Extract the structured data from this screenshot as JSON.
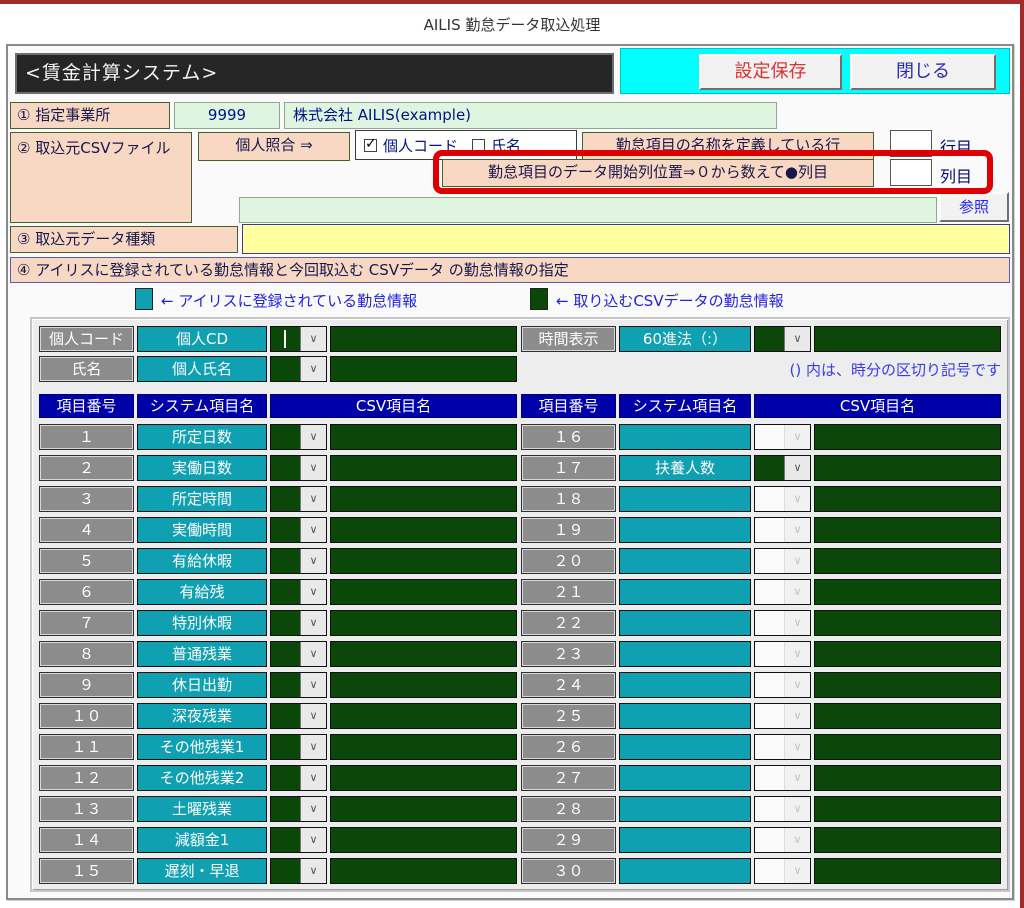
{
  "page": {
    "title": "AILIS 勤怠データ取込処理"
  },
  "header": {
    "system_title": "<賃金計算システム>",
    "save_label": "設定保存",
    "close_label": "閉じる"
  },
  "section1": {
    "label": "① 指定事業所",
    "office_code": "9999",
    "office_name": "株式会社 AILIS(example)"
  },
  "section2": {
    "label": "② 取込元CSVファイル",
    "match_label": "個人照合 ⇒",
    "checkboxes": [
      {
        "label": "個人コード",
        "checked": true
      },
      {
        "label": "氏名",
        "checked": false
      }
    ],
    "header_row_label": "勤怠項目の名称を定義している行",
    "header_row_value": "",
    "header_row_unit": "行目",
    "start_col_label": "勤怠項目のデータ開始列位置⇒０から数えて●列目",
    "start_col_value": "",
    "start_col_unit": "列目",
    "file_path": "",
    "browse_label": "参照"
  },
  "section3": {
    "label": "③ 取込元データ種類",
    "value": ""
  },
  "section4": {
    "banner": "④ アイリスに登録されている勤怠情報と今回取込む CSVデータ の勤怠情報の指定"
  },
  "legend": [
    {
      "label": "← アイリスに登録されている勤怠情報",
      "color": "#0fa0b2"
    },
    {
      "label": "← 取り込むCSVデータの勤怠情報",
      "color": "#0b4708"
    }
  ],
  "mapping": {
    "person_rows": [
      {
        "key": "個人コード",
        "system": "個人CD",
        "csv": ""
      },
      {
        "key": "氏名",
        "system": "個人氏名",
        "csv": ""
      }
    ],
    "time_row": {
      "key": "時間表示",
      "system": "60進法（:）",
      "csv": ""
    },
    "time_note": "() 内は、時分の区切り記号です",
    "headers": [
      "項目番号",
      "システム項目名",
      "CSV項目名"
    ],
    "left_rows": [
      {
        "num": "１",
        "system": "所定日数",
        "csv": ""
      },
      {
        "num": "２",
        "system": "実働日数",
        "csv": ""
      },
      {
        "num": "３",
        "system": "所定時間",
        "csv": ""
      },
      {
        "num": "４",
        "system": "実働時間",
        "csv": ""
      },
      {
        "num": "５",
        "system": "有給休暇",
        "csv": ""
      },
      {
        "num": "６",
        "system": "有給残",
        "csv": ""
      },
      {
        "num": "７",
        "system": "特別休暇",
        "csv": ""
      },
      {
        "num": "８",
        "system": "普通残業",
        "csv": ""
      },
      {
        "num": "９",
        "system": "休日出勤",
        "csv": ""
      },
      {
        "num": "１０",
        "system": "深夜残業",
        "csv": ""
      },
      {
        "num": "１１",
        "system": "その他残業1",
        "csv": ""
      },
      {
        "num": "１２",
        "system": "その他残業2",
        "csv": ""
      },
      {
        "num": "１３",
        "system": "土曜残業",
        "csv": ""
      },
      {
        "num": "１４",
        "system": "減額金1",
        "csv": ""
      },
      {
        "num": "１５",
        "system": "遅刻・早退",
        "csv": ""
      }
    ],
    "right_rows": [
      {
        "num": "１６",
        "system": "",
        "csv": ""
      },
      {
        "num": "１７",
        "system": "扶養人数",
        "csv": ""
      },
      {
        "num": "１８",
        "system": "",
        "csv": ""
      },
      {
        "num": "１９",
        "system": "",
        "csv": ""
      },
      {
        "num": "２０",
        "system": "",
        "csv": ""
      },
      {
        "num": "２１",
        "system": "",
        "csv": ""
      },
      {
        "num": "２２",
        "system": "",
        "csv": ""
      },
      {
        "num": "２３",
        "system": "",
        "csv": ""
      },
      {
        "num": "２４",
        "system": "",
        "csv": ""
      },
      {
        "num": "２５",
        "system": "",
        "csv": ""
      },
      {
        "num": "２６",
        "system": "",
        "csv": ""
      },
      {
        "num": "２７",
        "system": "",
        "csv": ""
      },
      {
        "num": "２８",
        "system": "",
        "csv": ""
      },
      {
        "num": "２９",
        "system": "",
        "csv": ""
      },
      {
        "num": "３０",
        "system": "",
        "csv": ""
      }
    ]
  },
  "colors": {
    "teal": "#0fa0b2",
    "dark_green": "#0b4708",
    "header_navy": "#0000a8",
    "peach": "#f8d8c2",
    "light_green": "#dff5df",
    "yellow": "#ffff9e",
    "cyan": "#00ffff",
    "annotation_red": "#de0000",
    "frame_red": "#a22b2b"
  },
  "icons": {
    "dropdown": "∨",
    "checked_glyph": "✓"
  }
}
